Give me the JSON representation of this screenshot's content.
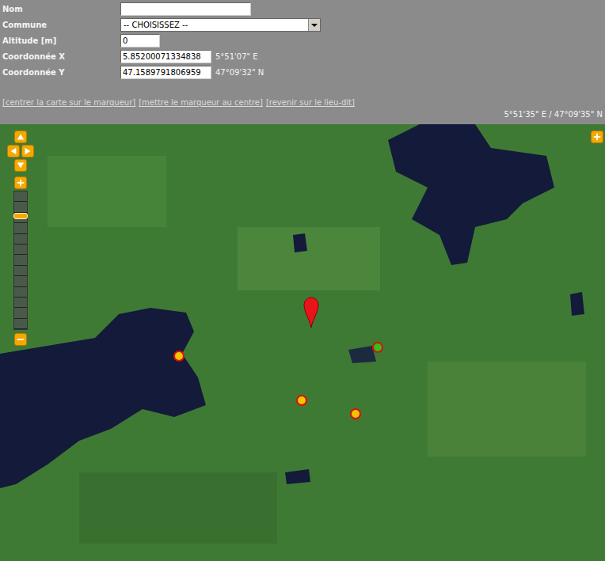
{
  "form": {
    "fields": [
      {
        "label": "Nom",
        "kind": "text",
        "value": ""
      },
      {
        "label": "Commune",
        "kind": "select",
        "value": "-- CHOISISSEZ --"
      },
      {
        "label": "Altitude [m]",
        "kind": "text",
        "value": "0"
      },
      {
        "label": "Coordonnée X",
        "kind": "text",
        "value": "5.85200071334838",
        "dms": "5°51'07\" E"
      },
      {
        "label": "Coordonnée Y",
        "kind": "text",
        "value": "47.1589791806959",
        "dms": "47°09'32\" N"
      }
    ]
  },
  "links": [
    "[centrer la carte sur le marqueur]",
    "[mettre le marqueur au centre]",
    "[revenir sur le lieu-dit]"
  ],
  "cursor_position": "5°51'35\" E / 47°09'35\" N",
  "map": {
    "zoom": {
      "level": 0.84
    },
    "markers": [
      {
        "kind": "pin",
        "color": "#e8141a"
      },
      {
        "kind": "dot",
        "color": "#f5c400"
      },
      {
        "kind": "dot",
        "color": "#f5c400"
      },
      {
        "kind": "dot",
        "color": "#f5c400"
      },
      {
        "kind": "dot",
        "color": "#2ec21a"
      }
    ]
  }
}
